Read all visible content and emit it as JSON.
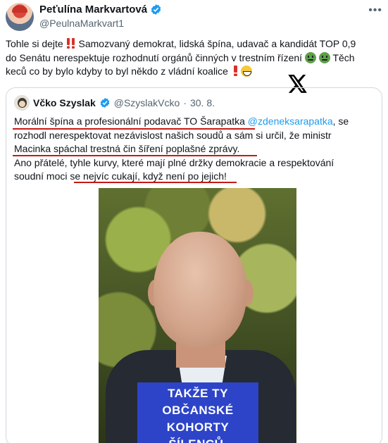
{
  "post": {
    "author": {
      "display_name": "Peťulína Markvartová",
      "handle": "@PeulnaMarkvart1",
      "verified": true
    },
    "more_icon": "more-horizontal-icon",
    "text_lines": [
      "Tohle si dejte ",
      " Samozvaný demokrat, lidská špína, udavač a kandidát TOP 0,9",
      "do Senátu nerespektuje rozhodnutí orgánů činných v trestním řízení ",
      " Těch",
      "keců co by bylo kdyby to byl někdo z vládní koalice "
    ]
  },
  "brand_icon": "x-logo-icon",
  "quoted": {
    "author": {
      "display_name": "Včko Szyslak",
      "handle": "@SzyslakVcko",
      "separator": "·",
      "date": "30. 8.",
      "verified": true
    },
    "text": {
      "l1_a": "Morální špína a profesionální podavač TO Šarapatka",
      "l1_mention": "@zdeneksarapatka",
      "l1_b": ", se",
      "l2": "rozhodl nerespektovat nezávislost našich soudů a sám si určil, že ministr",
      "l3": "Macinka spáchal trestná čin šíření poplašné zprávy.",
      "l4": "Ano přátelé, tyhle kurvy, které mají plné držky demokracie a respektování",
      "l5_a": "soudní moci ",
      "l5_b": "se nejvíc cukají, když není po jejich!"
    },
    "video_caption_line1": "TAKŽE TY OBČANSKÉ",
    "video_caption_line2": "KOHORTY ŠÍLENCŮ,"
  },
  "colors": {
    "verified_blue": "#1d9bf0",
    "underline_red": "#c41a14",
    "caption_blue": "#2d44c8"
  }
}
